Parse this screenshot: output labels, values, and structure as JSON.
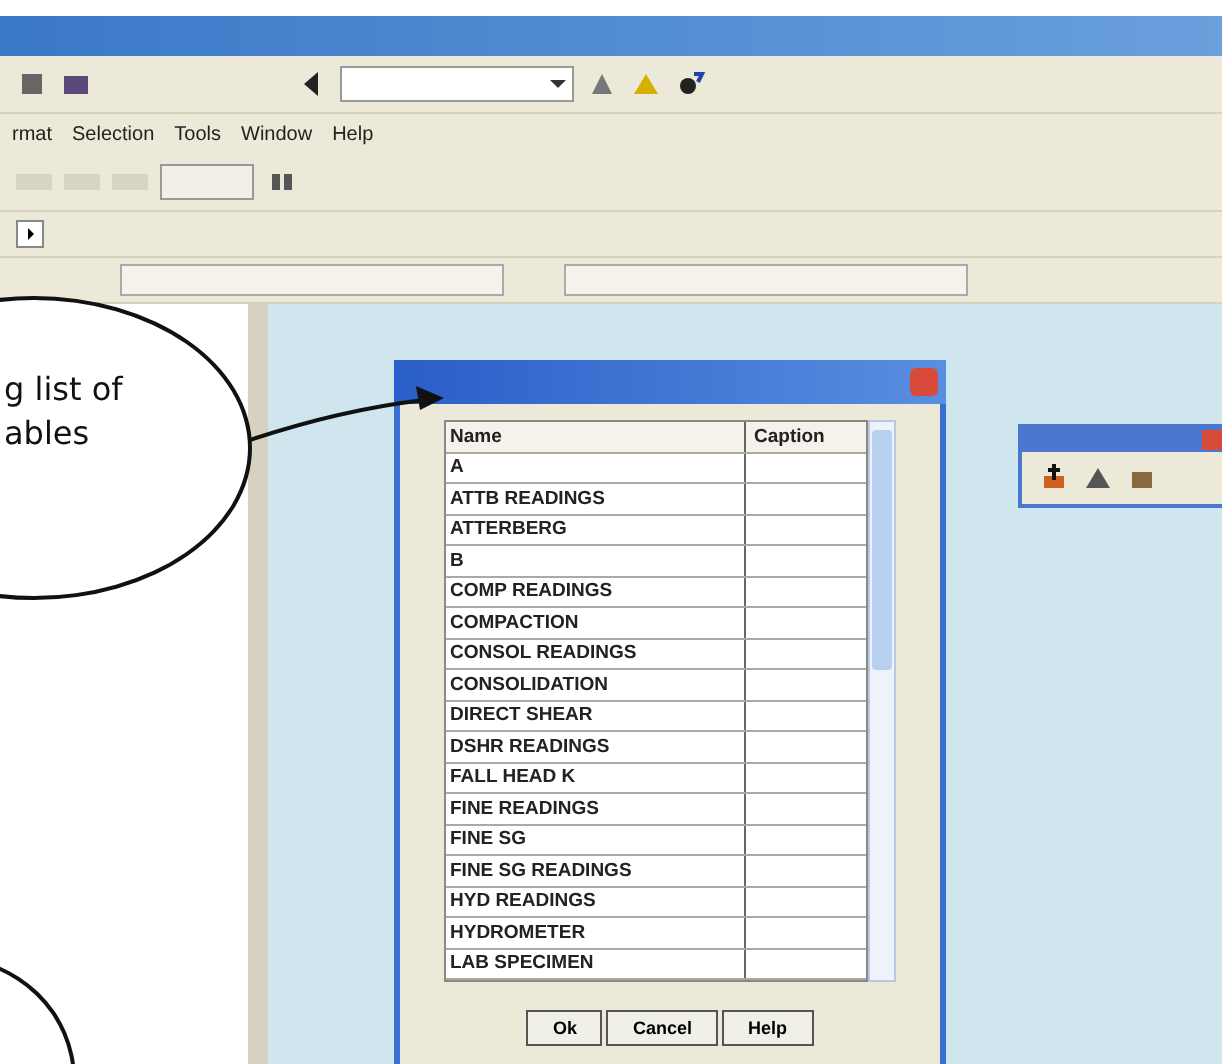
{
  "menu": [
    "rmat",
    "Selection",
    "Tools",
    "Window",
    "Help"
  ],
  "dialog": {
    "columns": [
      "Name",
      "Caption"
    ],
    "rows": [
      "A",
      "ATTB READINGS",
      "ATTERBERG",
      "B",
      "COMP READINGS",
      "COMPACTION",
      "CONSOL READINGS",
      "CONSOLIDATION",
      "DIRECT SHEAR",
      "DSHR READINGS",
      "FALL HEAD K",
      "FINE READINGS",
      "FINE SG",
      "FINE SG READINGS",
      "HYD READINGS",
      "HYDROMETER",
      "LAB SPECIMEN"
    ],
    "buttons": [
      "Ok",
      "Cancel",
      "Help"
    ]
  },
  "callout": {
    "lines": [
      "g list of",
      "ables"
    ]
  }
}
